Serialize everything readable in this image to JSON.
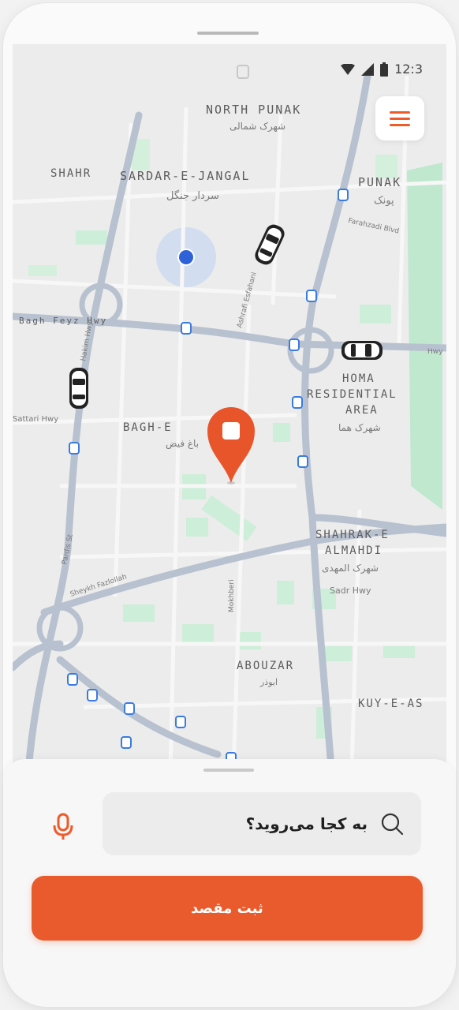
{
  "status_bar": {
    "time": "12:3"
  },
  "map": {
    "labels": {
      "north_punak": "NORTH PUNAK",
      "north_punak_fa": "شهرک شمالی",
      "shahr": "SHAHR",
      "sardar_e_jangal": "SARDAR-E-JANGAL",
      "sardar_e_jangal_fa": "سردار جنگل",
      "punak": "PUNAK",
      "punak_fa": "پونک",
      "punak_road": "Farahzadi Blvd",
      "bagh_e": "BAGH-E",
      "bagh_e_fa": "باغ فیض",
      "homa": "HOMA",
      "residential": "RESIDENTIAL",
      "area": "AREA",
      "homa_fa": "شهرک هما",
      "shahrak": "SHAHRAK-E",
      "almahdi": "ALMAHDI",
      "almahdi_fa": "شهرک المهدی",
      "almahdi_road": "Sadr Hwy",
      "aboudar": "ABOUZAR",
      "aboudar_fa": "ابوذر",
      "kut": "KUY-E-AS",
      "road_left": "Sattari Hwy",
      "road_top_left": "Bagh Feyz Hwy",
      "road_mid": "Hakim Hwy",
      "road_vertical": "Ashrafi Esfahani",
      "road_center": "Mokhberi",
      "road_diag": "Pardis St",
      "road_right_label": "Hwy",
      "road_bottom_left": "Sheykh Fazlollah"
    }
  },
  "search": {
    "placeholder": "به کجا می‌روید؟"
  },
  "cta": {
    "label": "ثبت مقصد"
  },
  "colors": {
    "accent": "#e95a2c",
    "user_dot": "#2f62d8",
    "park": "#bfe8cf",
    "road": "#b8c1cf"
  },
  "icons": {
    "menu": "hamburger-icon",
    "mic": "mic-icon",
    "search": "search-icon",
    "destination": "map-pin-icon",
    "car": "car-icon"
  }
}
